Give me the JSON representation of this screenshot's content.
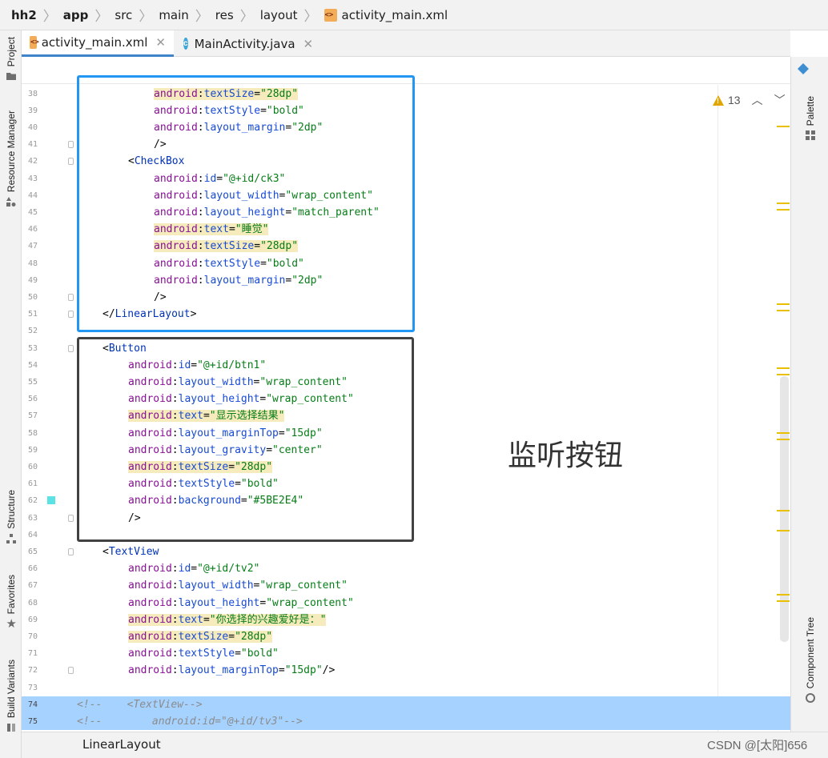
{
  "breadcrumb": {
    "items": [
      "hh2",
      "app",
      "src",
      "main",
      "res",
      "layout"
    ],
    "file": "activity_main.xml"
  },
  "tabs": [
    {
      "label": "activity_main.xml",
      "active": true,
      "icon": "xml-file-icon"
    },
    {
      "label": "MainActivity.java",
      "active": false,
      "icon": "java-class-icon"
    }
  ],
  "left_tool_windows": [
    "Project",
    "Resource Manager",
    "Structure",
    "Favorites",
    "Build Variants"
  ],
  "right_tool_windows": [
    "Palette",
    "Component Tree"
  ],
  "inspection": {
    "warnings": "13"
  },
  "code_lines": [
    {
      "n": "38",
      "segs": [
        [
          "i2",
          ""
        ],
        [
          "ns",
          "android"
        ],
        [
          "p",
          ":"
        ],
        [
          "an",
          "textSize"
        ],
        [
          "p",
          "="
        ],
        [
          "s",
          "\"28dp\""
        ]
      ],
      "hl": true
    },
    {
      "n": "39",
      "segs": [
        [
          "i2",
          ""
        ],
        [
          "ns",
          "android"
        ],
        [
          "p",
          ":"
        ],
        [
          "an",
          "textStyle"
        ],
        [
          "p",
          "="
        ],
        [
          "s",
          "\"bold\""
        ]
      ]
    },
    {
      "n": "40",
      "segs": [
        [
          "i2",
          ""
        ],
        [
          "ns",
          "android"
        ],
        [
          "p",
          ":"
        ],
        [
          "an",
          "layout_margin"
        ],
        [
          "p",
          "="
        ],
        [
          "s",
          "\"2dp\""
        ]
      ]
    },
    {
      "n": "41",
      "segs": [
        [
          "i2",
          ""
        ],
        [
          "p",
          "/>"
        ]
      ]
    },
    {
      "n": "42",
      "segs": [
        [
          "i1",
          ""
        ],
        [
          "p",
          "<"
        ],
        [
          "t",
          "CheckBox"
        ]
      ]
    },
    {
      "n": "43",
      "segs": [
        [
          "i2",
          ""
        ],
        [
          "ns",
          "android"
        ],
        [
          "p",
          ":"
        ],
        [
          "an",
          "id"
        ],
        [
          "p",
          "="
        ],
        [
          "s",
          "\"@+id/ck3\""
        ]
      ]
    },
    {
      "n": "44",
      "segs": [
        [
          "i2",
          ""
        ],
        [
          "ns",
          "android"
        ],
        [
          "p",
          ":"
        ],
        [
          "an",
          "layout_width"
        ],
        [
          "p",
          "="
        ],
        [
          "s",
          "\"wrap_content\""
        ]
      ]
    },
    {
      "n": "45",
      "segs": [
        [
          "i2",
          ""
        ],
        [
          "ns",
          "android"
        ],
        [
          "p",
          ":"
        ],
        [
          "an",
          "layout_height"
        ],
        [
          "p",
          "="
        ],
        [
          "s",
          "\"match_parent\""
        ]
      ]
    },
    {
      "n": "46",
      "segs": [
        [
          "i2",
          ""
        ],
        [
          "ns",
          "android"
        ],
        [
          "p",
          ":"
        ],
        [
          "an",
          "text"
        ],
        [
          "p",
          "="
        ],
        [
          "s",
          "\"睡觉\""
        ]
      ],
      "hl": true
    },
    {
      "n": "47",
      "segs": [
        [
          "i2",
          ""
        ],
        [
          "ns",
          "android"
        ],
        [
          "p",
          ":"
        ],
        [
          "an",
          "textSize"
        ],
        [
          "p",
          "="
        ],
        [
          "s",
          "\"28dp\""
        ]
      ],
      "hl": true
    },
    {
      "n": "48",
      "segs": [
        [
          "i2",
          ""
        ],
        [
          "ns",
          "android"
        ],
        [
          "p",
          ":"
        ],
        [
          "an",
          "textStyle"
        ],
        [
          "p",
          "="
        ],
        [
          "s",
          "\"bold\""
        ]
      ]
    },
    {
      "n": "49",
      "segs": [
        [
          "i2",
          ""
        ],
        [
          "ns",
          "android"
        ],
        [
          "p",
          ":"
        ],
        [
          "an",
          "layout_margin"
        ],
        [
          "p",
          "="
        ],
        [
          "s",
          "\"2dp\""
        ]
      ]
    },
    {
      "n": "50",
      "segs": [
        [
          "i2",
          ""
        ],
        [
          "p",
          "/>"
        ]
      ]
    },
    {
      "n": "51",
      "segs": [
        [
          "i0",
          ""
        ],
        [
          "p",
          "</"
        ],
        [
          "t",
          "LinearLayout"
        ],
        [
          "p",
          ">"
        ]
      ]
    },
    {
      "n": "52",
      "segs": []
    },
    {
      "n": "53",
      "segs": [
        [
          "i0",
          ""
        ],
        [
          "p",
          "<"
        ],
        [
          "t",
          "Button"
        ]
      ]
    },
    {
      "n": "54",
      "segs": [
        [
          "i1",
          ""
        ],
        [
          "ns",
          "android"
        ],
        [
          "p",
          ":"
        ],
        [
          "an",
          "id"
        ],
        [
          "p",
          "="
        ],
        [
          "s",
          "\"@+id/btn1\""
        ]
      ]
    },
    {
      "n": "55",
      "segs": [
        [
          "i1",
          ""
        ],
        [
          "ns",
          "android"
        ],
        [
          "p",
          ":"
        ],
        [
          "an",
          "layout_width"
        ],
        [
          "p",
          "="
        ],
        [
          "s",
          "\"wrap_content\""
        ]
      ]
    },
    {
      "n": "56",
      "segs": [
        [
          "i1",
          ""
        ],
        [
          "ns",
          "android"
        ],
        [
          "p",
          ":"
        ],
        [
          "an",
          "layout_height"
        ],
        [
          "p",
          "="
        ],
        [
          "s",
          "\"wrap_content\""
        ]
      ]
    },
    {
      "n": "57",
      "segs": [
        [
          "i1",
          ""
        ],
        [
          "ns",
          "android"
        ],
        [
          "p",
          ":"
        ],
        [
          "an",
          "text"
        ],
        [
          "p",
          "="
        ],
        [
          "s",
          "\"显示选择结果\""
        ]
      ],
      "hl": true
    },
    {
      "n": "58",
      "segs": [
        [
          "i1",
          ""
        ],
        [
          "ns",
          "android"
        ],
        [
          "p",
          ":"
        ],
        [
          "an",
          "layout_marginTop"
        ],
        [
          "p",
          "="
        ],
        [
          "s",
          "\"15dp\""
        ]
      ]
    },
    {
      "n": "59",
      "segs": [
        [
          "i1",
          ""
        ],
        [
          "ns",
          "android"
        ],
        [
          "p",
          ":"
        ],
        [
          "an",
          "layout_gravity"
        ],
        [
          "p",
          "="
        ],
        [
          "s",
          "\"center\""
        ]
      ]
    },
    {
      "n": "60",
      "segs": [
        [
          "i1",
          ""
        ],
        [
          "ns",
          "android"
        ],
        [
          "p",
          ":"
        ],
        [
          "an",
          "textSize"
        ],
        [
          "p",
          "="
        ],
        [
          "s",
          "\"28dp\""
        ]
      ],
      "hl": true
    },
    {
      "n": "61",
      "segs": [
        [
          "i1",
          ""
        ],
        [
          "ns",
          "android"
        ],
        [
          "p",
          ":"
        ],
        [
          "an",
          "textStyle"
        ],
        [
          "p",
          "="
        ],
        [
          "s",
          "\"bold\""
        ]
      ]
    },
    {
      "n": "62",
      "segs": [
        [
          "i1",
          ""
        ],
        [
          "ns",
          "android"
        ],
        [
          "p",
          ":"
        ],
        [
          "an",
          "background"
        ],
        [
          "p",
          "="
        ],
        [
          "s",
          "\"#5BE2E4\""
        ]
      ],
      "swatch": "#5BE2E4"
    },
    {
      "n": "63",
      "segs": [
        [
          "i1",
          ""
        ],
        [
          "p",
          "/>"
        ]
      ]
    },
    {
      "n": "64",
      "segs": []
    },
    {
      "n": "65",
      "segs": [
        [
          "i0",
          ""
        ],
        [
          "p",
          "<"
        ],
        [
          "t",
          "TextView"
        ]
      ]
    },
    {
      "n": "66",
      "segs": [
        [
          "i1",
          ""
        ],
        [
          "ns",
          "android"
        ],
        [
          "p",
          ":"
        ],
        [
          "an",
          "id"
        ],
        [
          "p",
          "="
        ],
        [
          "s",
          "\"@+id/tv2\""
        ]
      ]
    },
    {
      "n": "67",
      "segs": [
        [
          "i1",
          ""
        ],
        [
          "ns",
          "android"
        ],
        [
          "p",
          ":"
        ],
        [
          "an",
          "layout_width"
        ],
        [
          "p",
          "="
        ],
        [
          "s",
          "\"wrap_content\""
        ]
      ]
    },
    {
      "n": "68",
      "segs": [
        [
          "i1",
          ""
        ],
        [
          "ns",
          "android"
        ],
        [
          "p",
          ":"
        ],
        [
          "an",
          "layout_height"
        ],
        [
          "p",
          "="
        ],
        [
          "s",
          "\"wrap_content\""
        ]
      ]
    },
    {
      "n": "69",
      "segs": [
        [
          "i1",
          ""
        ],
        [
          "ns",
          "android"
        ],
        [
          "p",
          ":"
        ],
        [
          "an",
          "text"
        ],
        [
          "p",
          "="
        ],
        [
          "s",
          "\"你选择的兴趣爱好是：\""
        ]
      ],
      "hl": true
    },
    {
      "n": "70",
      "segs": [
        [
          "i1",
          ""
        ],
        [
          "ns",
          "android"
        ],
        [
          "p",
          ":"
        ],
        [
          "an",
          "textSize"
        ],
        [
          "p",
          "="
        ],
        [
          "s",
          "\"28dp\""
        ]
      ],
      "hl": true
    },
    {
      "n": "71",
      "segs": [
        [
          "i1",
          ""
        ],
        [
          "ns",
          "android"
        ],
        [
          "p",
          ":"
        ],
        [
          "an",
          "textStyle"
        ],
        [
          "p",
          "="
        ],
        [
          "s",
          "\"bold\""
        ]
      ]
    },
    {
      "n": "72",
      "segs": [
        [
          "i1",
          ""
        ],
        [
          "ns",
          "android"
        ],
        [
          "p",
          ":"
        ],
        [
          "an",
          "layout_marginTop"
        ],
        [
          "p",
          "="
        ],
        [
          "s",
          "\"15dp\""
        ],
        [
          "p",
          "/>"
        ]
      ]
    },
    {
      "n": "73",
      "segs": []
    },
    {
      "n": "74",
      "segs": [
        [
          "c",
          "<!--    <TextView-->"
        ]
      ],
      "sel": true
    },
    {
      "n": "75",
      "segs": [
        [
          "c",
          "<!--        android:id=\"@+id/tv3\"-->"
        ]
      ],
      "sel": true
    }
  ],
  "fold_lines": [
    "41",
    "42",
    "50",
    "51",
    "53",
    "63",
    "65",
    "72"
  ],
  "annotation_text": "监听按钮",
  "status": {
    "breadcrumb": "LinearLayout"
  },
  "watermark": "CSDN @[太阳]656",
  "colors": {
    "accent": "#4083c9",
    "blue_box": "#2196f3",
    "dark_box": "#424242",
    "warning": "#e2a500",
    "selection": "#a6d2ff"
  }
}
